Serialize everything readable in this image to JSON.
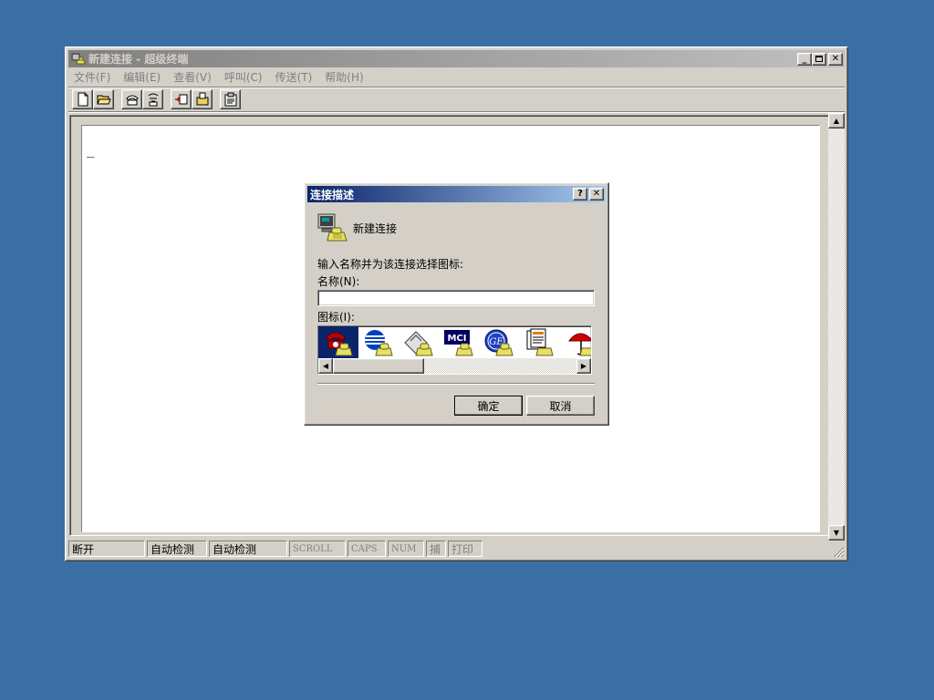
{
  "main_window": {
    "title": "新建连接 - 超级终端",
    "menu": [
      "文件(F)",
      "编辑(E)",
      "查看(V)",
      "呼叫(C)",
      "传送(T)",
      "帮助(H)"
    ],
    "toolbar_icons": [
      "new-file-icon",
      "open-folder-icon",
      "dial-icon",
      "disconnect-icon",
      "send-icon",
      "receive-icon",
      "properties-icon"
    ],
    "cursor": "_",
    "status": [
      "断开",
      "自动检测",
      "自动检测",
      "SCROLL",
      "CAPS",
      "NUM",
      "捕",
      "打印"
    ]
  },
  "dialog": {
    "title": "连接描述",
    "connection_name": "新建连接",
    "prompt": "输入名称并为该连接选择图标:",
    "name_label": "名称(N):",
    "name_value": "",
    "icon_label": "图标(I):",
    "ok_label": "确定",
    "cancel_label": "取消",
    "icons": [
      "red-phone-icon",
      "globe-phone-icon",
      "fax-phone-icon",
      "mci-phone-icon",
      "ge-phone-icon",
      "documents-phone-icon",
      "umbrella-phone-icon"
    ]
  },
  "colors": {
    "desktop": "#3a6ea5",
    "face": "#d4d0c8",
    "active_title": "#0a246a",
    "inactive_title": "#808080"
  }
}
